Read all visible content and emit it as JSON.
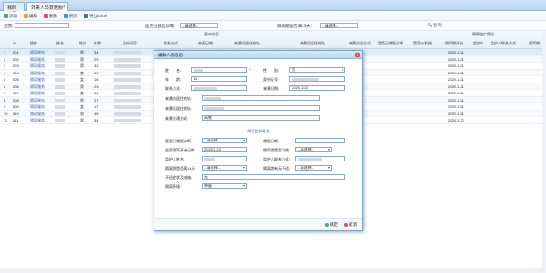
{
  "tabs": [
    {
      "label": "我的主页"
    },
    {
      "label": "外来人员数据服务",
      "close": "×"
    }
  ],
  "toolbar": {
    "add": "添加",
    "edit": "编辑",
    "delete": "删除",
    "refresh": "刷新",
    "export": "导出Excel"
  },
  "filters": {
    "scope_label": "范围:",
    "medical_label": "是否已就医诊断:",
    "medical_value": "--请选择--",
    "isolation_label": "隔离期是否满14天:",
    "isolation_value": "--请选择--",
    "search_label": "查询"
  },
  "grid": {
    "group_basic": "基本信息",
    "group_monitor": "隔离监护情况",
    "headers": [
      "ID",
      "操作",
      "姓名",
      "性别",
      "年龄",
      "身份证号",
      "联系方式",
      "来黄日期",
      "来黄前居住地址",
      "来黄后居住地址",
      "来黄交通方式",
      "是否已就医诊断",
      "是否有发热",
      "隔离期开始",
      "监护人",
      "监护人联系方式",
      "隔离期"
    ],
    "rows": [
      {
        "id": "1",
        "num": "001",
        "op": "隔离服务",
        "name": "■■",
        "sex": "男",
        "age": "34",
        "date": "2020.1.21"
      },
      {
        "id": "2",
        "num": "002",
        "op": "隔离服务",
        "name": "■■",
        "sex": "男",
        "age": "29",
        "date": "2020.1.21"
      },
      {
        "id": "3",
        "num": "003",
        "op": "隔离服务",
        "name": "■■",
        "sex": "男",
        "age": "32",
        "date": "2020.1.21"
      },
      {
        "id": "4",
        "num": "004",
        "op": "隔离服务",
        "name": "■■",
        "sex": "女",
        "age": "19",
        "date": "2020.1.21"
      },
      {
        "id": "5",
        "num": "005",
        "op": "隔离服务",
        "name": "■■",
        "sex": "女",
        "age": "16",
        "date": "2020.1.21"
      },
      {
        "id": "6",
        "num": "006",
        "op": "隔离服务",
        "name": "■■",
        "sex": "男",
        "age": "23",
        "date": "2020.1.21"
      },
      {
        "id": "7",
        "num": "007",
        "op": "隔离服务",
        "name": "■■",
        "sex": "女",
        "age": "54",
        "date": "2020.1.21"
      },
      {
        "id": "8",
        "num": "008",
        "op": "隔离服务",
        "name": "■■",
        "sex": "男",
        "age": "27",
        "date": "2020.1.21"
      },
      {
        "id": "9",
        "num": "009",
        "op": "隔离服务",
        "name": "■■",
        "sex": "女",
        "age": "17",
        "date": "2020.1.21"
      },
      {
        "id": "10",
        "num": "010",
        "op": "隔离服务",
        "name": "■■",
        "sex": "男",
        "age": "45",
        "date": "2020.1.21"
      },
      {
        "id": "11",
        "num": "011",
        "op": "隔离服务",
        "name": "■■",
        "sex": "男",
        "age": "34",
        "date": "2020.1.22"
      }
    ]
  },
  "dialog": {
    "title": "编辑人员信息",
    "close": "×",
    "name_label": "姓　　名:",
    "sex_label": "性　　别:",
    "sex_value": "男",
    "age_label": "年　　龄:",
    "age_value": "34",
    "idcard_label": "身份证号:",
    "phone_label": "联系方式:",
    "arrive_label": "来黄日期:",
    "arrive_value": "2020.1.22",
    "before_label": "来黄前居住地址:",
    "after_label": "来黄后居住地址:",
    "transport_label": "来黄交通方式:",
    "transport_value": "高铁",
    "section": "隔离监护情况",
    "medical_label": "是否已就医诊断:",
    "medical_value": "--请选择--",
    "visit_label": "就医日期:",
    "start_label": "居家隔离开始日期:",
    "start_value": "2020.1.23",
    "fever_label": "隔离期是否发热:",
    "fever_value": "--请选择--",
    "guardian_label": "监护人姓名:",
    "guardian_phone_label": "监护人联系方式:",
    "full_label": "隔离期是否满14天:",
    "full_value": "--请选择--",
    "release_label": "隔离期有无不适:",
    "release_value": "--请选择--",
    "discomfort_label": "不适症状及措施:",
    "discomfort_value": "无",
    "env_label": "隔离环境:",
    "env_value": "单屋",
    "ok": "确定",
    "cancel": "取消"
  }
}
